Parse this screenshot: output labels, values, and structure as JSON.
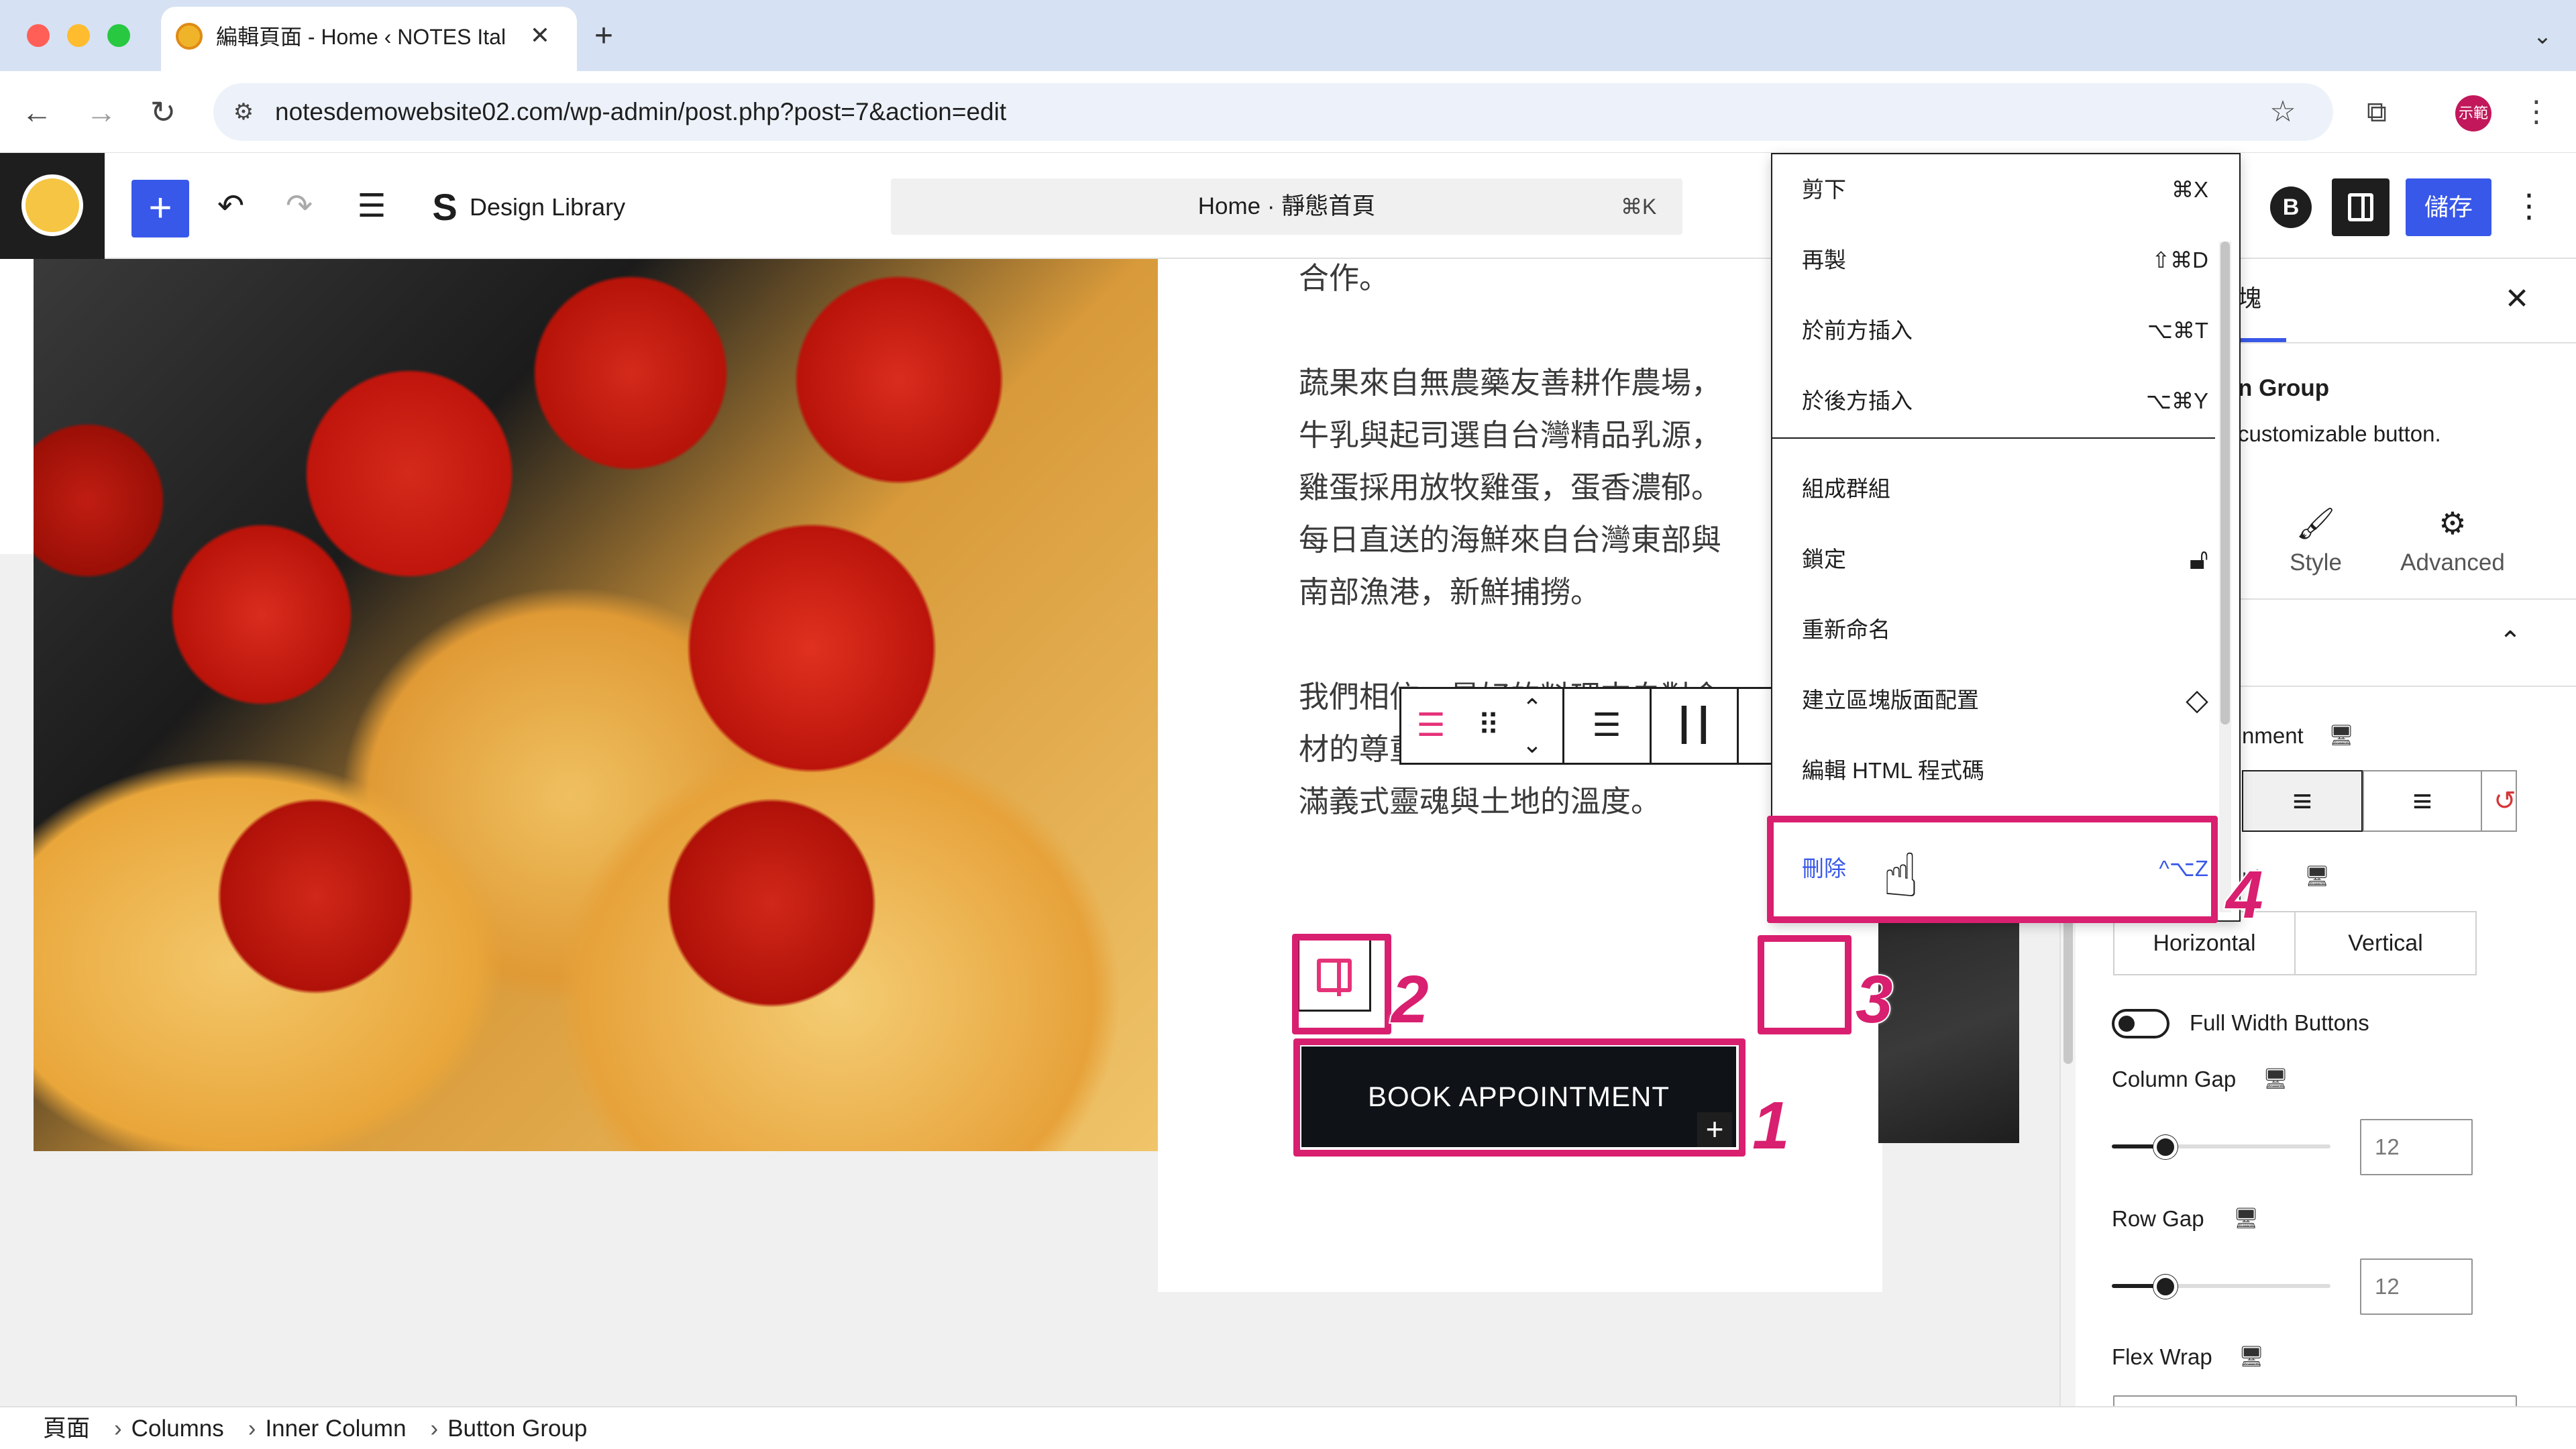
{
  "browser": {
    "tab_title": "編輯頁面 - Home ‹ NOTES Ital",
    "url": "notesdemowebsite02.com/wp-admin/post.php?post=7&action=edit",
    "profile_label": "示範"
  },
  "editor": {
    "design_library_label": "Design Library",
    "document_title": "Home · 靜態首頁",
    "command_shortcut": "⌘K",
    "save_label": "儲存",
    "hdr_b_label": "B"
  },
  "content": {
    "paragraphs": [
      "合作。",
      "蔬果來自無農藥友善耕作農場，牛乳與起司選自台灣精品乳源，雞蛋採用放牧雞蛋，蛋香濃郁。每日直送的海鮮來自台灣東部與南部漁港，新鮮捕撈。",
      "我們相信，最好的料理來自對食材的尊重與熱愛，讓每一口都充滿義式靈魂與土地的溫度。"
    ],
    "button_label": "BOOK APPOINTMENT"
  },
  "annotations": [
    "1",
    "2",
    "3",
    "4"
  ],
  "block_menu": {
    "items": [
      {
        "label": "剪下",
        "shortcut": "⌘X"
      },
      {
        "label": "再製",
        "shortcut": "⇧⌘D"
      },
      {
        "label": "於前方插入",
        "shortcut": "⌥⌘T"
      },
      {
        "label": "於後方插入",
        "shortcut": "⌥⌘Y"
      },
      {
        "label": "組成群組",
        "shortcut": ""
      },
      {
        "label": "鎖定",
        "shortcut": ""
      },
      {
        "label": "重新命名",
        "shortcut": ""
      },
      {
        "label": "建立區塊版面配置",
        "shortcut": ""
      },
      {
        "label": "編輯 HTML 程式碼",
        "shortcut": ""
      },
      {
        "label": "刪除",
        "shortcut": "^⌥Z"
      }
    ]
  },
  "sidebar": {
    "tab_label": "塊",
    "block_title": "n Group",
    "block_desc": "customizable button.",
    "tabs": [
      {
        "label": "Style",
        "icon": "brush-icon"
      },
      {
        "label": "Advanced",
        "icon": "gear-icon"
      }
    ],
    "alignment_label": "nment",
    "orientation_label": "nt",
    "orientation_options": [
      "Horizontal",
      "Vertical"
    ],
    "full_width_label": "Full Width Buttons",
    "full_width_on": false,
    "column_gap_label": "Column Gap",
    "column_gap_value": "12",
    "row_gap_label": "Row Gap",
    "row_gap_value": "12",
    "flex_wrap_label": "Flex Wrap"
  },
  "breadcrumb": [
    "頁面",
    "Columns",
    "Inner Column",
    "Button Group"
  ],
  "colors": {
    "accent": "#3858e9",
    "highlight": "#d91f6f"
  }
}
